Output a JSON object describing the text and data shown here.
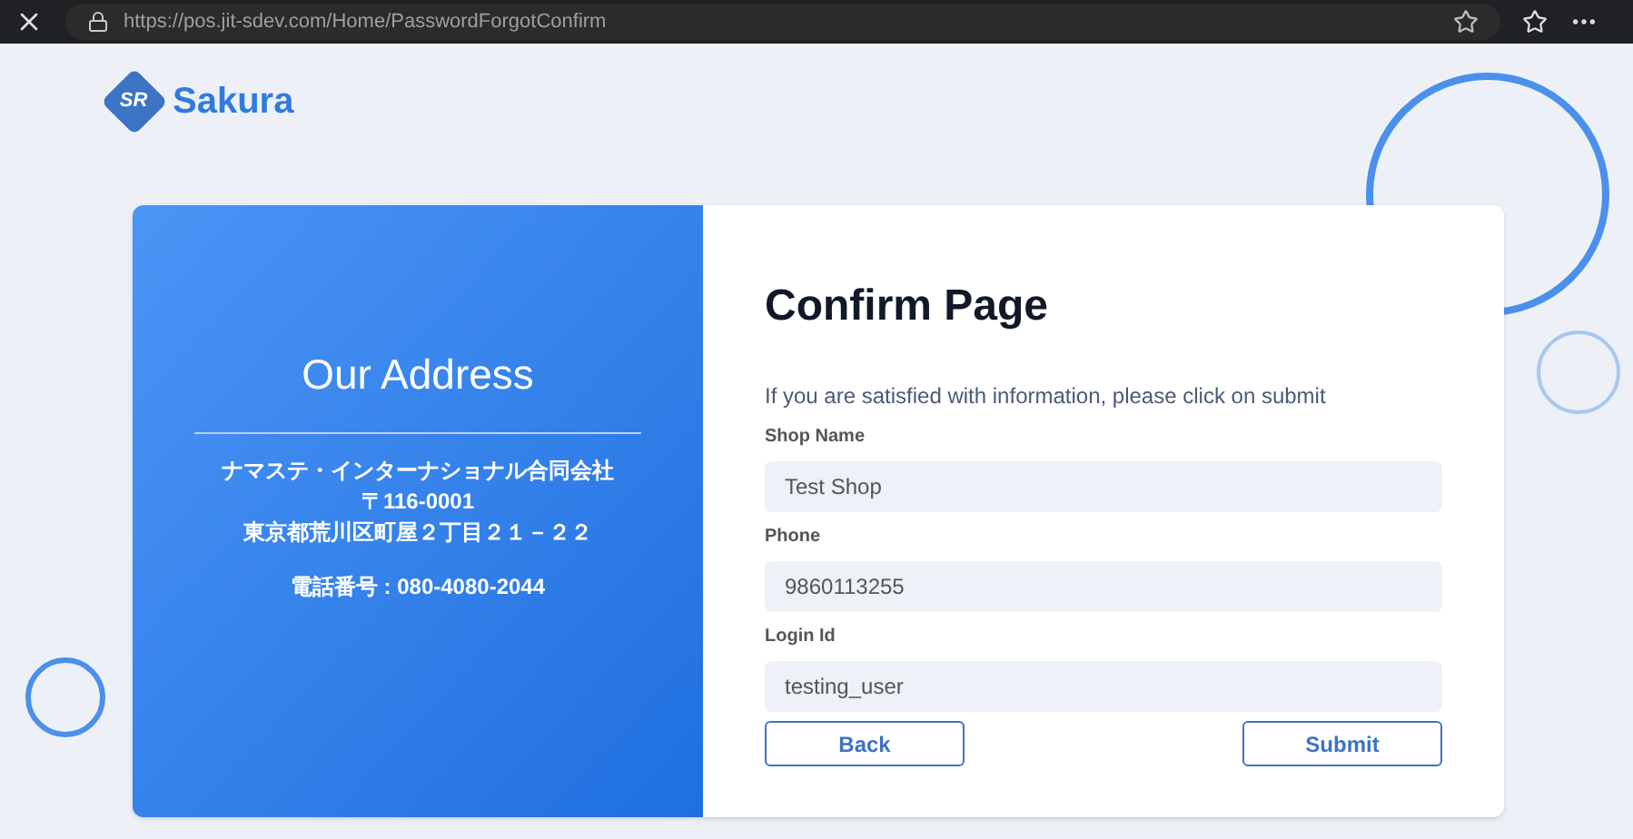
{
  "browser": {
    "url": "https://pos.jit-sdev.com/Home/PasswordForgotConfirm"
  },
  "logo": {
    "mark": "SR",
    "name": "Sakura"
  },
  "address": {
    "title": "Our Address",
    "lines": [
      "ナマステ・インターナショナル合同会社",
      "〒116-0001",
      "東京都荒川区町屋２丁目２１－２２"
    ],
    "phone": "電話番号 : 080-4080-2044"
  },
  "form": {
    "title": "Confirm Page",
    "intro": "If you are satisfied with information, please click on submit",
    "fields": [
      {
        "label": "Shop Name",
        "value": "Test Shop"
      },
      {
        "label": "Phone",
        "value": "9860113255"
      },
      {
        "label": "Login Id",
        "value": "testing_user"
      }
    ],
    "buttons": [
      "Back",
      "Submit"
    ]
  }
}
